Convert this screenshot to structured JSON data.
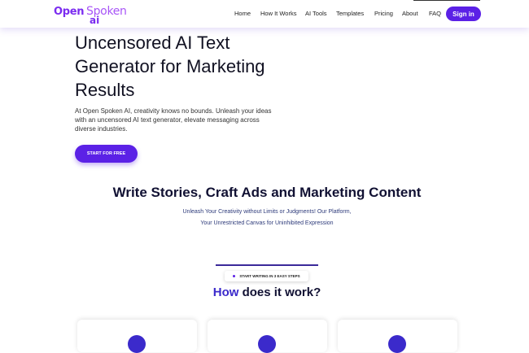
{
  "header": {
    "logo": {
      "open": "Open",
      "spoken": "Spoken",
      "ai": "ai"
    },
    "nav": [
      {
        "label": "Home"
      },
      {
        "label": "How It Works"
      },
      {
        "label": "AI Tools"
      },
      {
        "label": "Templates"
      },
      {
        "label": "Pricing"
      },
      {
        "label": "About"
      },
      {
        "label": "FAQ"
      }
    ],
    "signin_label": "Sign in"
  },
  "hero": {
    "title": "Uncensored AI Text Generator for Marketing Results",
    "description": "At Open Spoken AI, creativity knows no bounds. Unleash your ideas with an uncensored AI text generator, elevate messaging across diverse industries.",
    "cta_label": "START FOR FREE"
  },
  "features": {
    "title": "Write Stories, Craft Ads and Marketing Content",
    "subtitle": "Unleash Your Creativity without Limits or Judgments! Our Platform, Your Unrestricted Canvas for Uninhibited Expression"
  },
  "steps": {
    "badge": "START WRITING IN 3 EASY STEPS",
    "title_accent": "How",
    "title_rest": " does it work?"
  },
  "colors": {
    "accent": "#5b21e6",
    "logo_purple": "#7b2cf0",
    "logo_light": "#a855f7",
    "heading_accent": "#3b2acb"
  }
}
